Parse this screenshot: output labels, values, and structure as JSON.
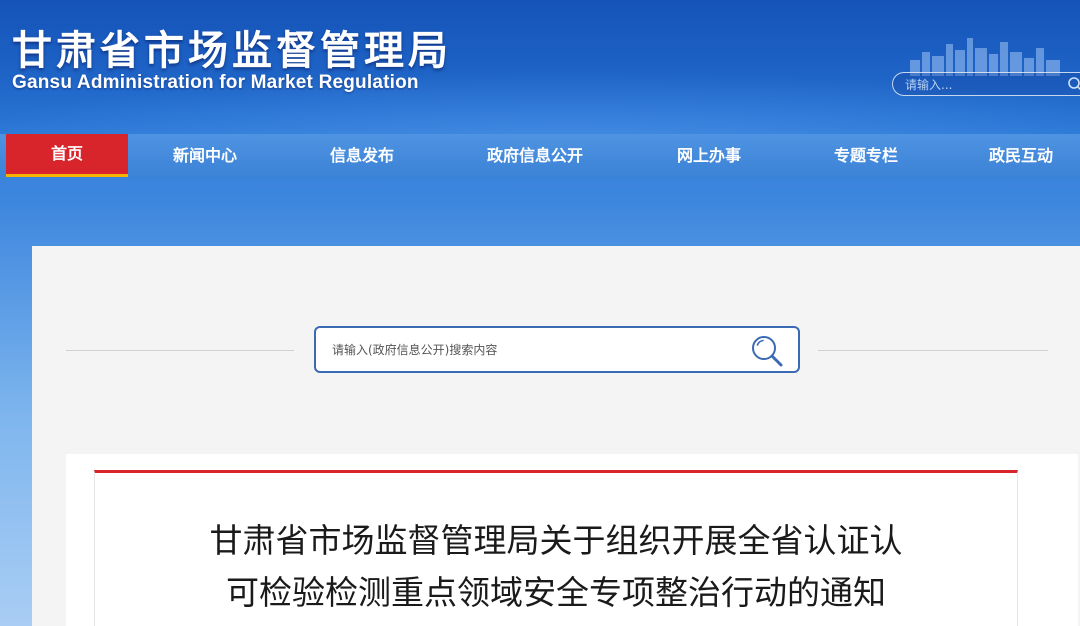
{
  "header": {
    "title_cn": "甘肃省市场监督管理局",
    "title_en": "Gansu Administration for Market Regulation",
    "search_placeholder": "请输入..."
  },
  "nav": {
    "items": [
      {
        "label": "首页",
        "active": true
      },
      {
        "label": "新闻中心",
        "active": false
      },
      {
        "label": "信息发布",
        "active": false
      },
      {
        "label": "政府信息公开",
        "active": false
      },
      {
        "label": "网上办事",
        "active": false
      },
      {
        "label": "专题专栏",
        "active": false
      },
      {
        "label": "政民互动",
        "active": false
      }
    ]
  },
  "search": {
    "placeholder": "请输入(政府信息公开)搜索内容",
    "icon": "search-icon"
  },
  "article": {
    "title_line1": "甘肃省市场监督管理局关于组织开展全省认证认",
    "title_line2": "可检验检测重点领域安全专项整治行动的通知"
  },
  "colors": {
    "header_blue": "#1e63c6",
    "nav_blue": "#4189da",
    "active_red": "#d8242b",
    "active_underline": "#f7b500",
    "search_border": "#3a6ab4"
  }
}
